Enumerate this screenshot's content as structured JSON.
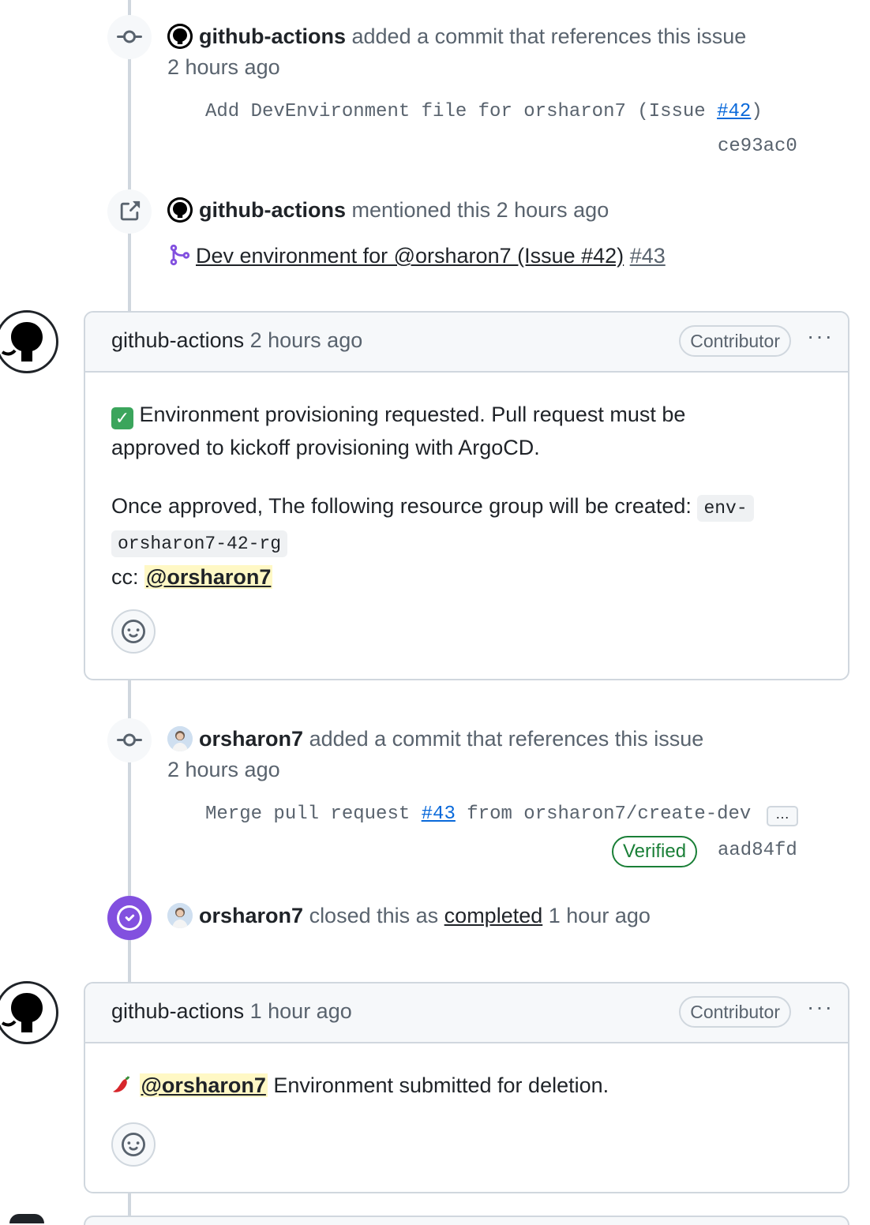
{
  "events": {
    "commit1": {
      "actor": "github-actions",
      "action": "added a commit that references this issue",
      "time": "2 hours ago",
      "message_prefix": "Add DevEnvironment file for orsharon7 (Issue ",
      "message_link": "#42",
      "message_suffix": ")",
      "sha": "ce93ac0"
    },
    "mention": {
      "actor": "github-actions",
      "action": "mentioned this 2 hours ago",
      "pr_title": "Dev environment for @orsharon7 (Issue #42)",
      "pr_number": "#43"
    },
    "commit2": {
      "actor": "orsharon7",
      "action": "added a commit that references this issue",
      "time": "2 hours ago",
      "message_prefix": "Merge pull request ",
      "message_link": "#43",
      "message_suffix": " from orsharon7/create-dev",
      "ellipsis": "…",
      "verified": "Verified",
      "sha": "aad84fd"
    },
    "closed": {
      "actor": "orsharon7",
      "action": "closed this as",
      "reason": "completed",
      "time": "1 hour ago"
    }
  },
  "comments": [
    {
      "author": "github-actions",
      "time": "2 hours ago",
      "role": "Contributor",
      "menu": "···",
      "line1": "Environment provisioning requested. Pull request must be",
      "line2": "approved to kickoff provisioning with ArgoCD.",
      "line3": "Once approved, The following resource group will be created:",
      "code1": "env-",
      "code2": "orsharon7-42-rg",
      "cc_label": "cc:",
      "mention": "@orsharon7"
    },
    {
      "author": "github-actions",
      "time": "1 hour ago",
      "role": "Contributor",
      "menu": "···",
      "mention": "@orsharon7",
      "text": "Environment submitted for deletion."
    }
  ],
  "icons": {
    "commit": "git-commit-icon",
    "crossref": "link-external-icon",
    "pr": "git-pull-request-icon",
    "closed": "check-circle-icon",
    "react": "smiley-icon",
    "check": "white-check-mark-emoji",
    "pepper": "hot-pepper-emoji"
  },
  "colors": {
    "link": "#0969da",
    "purple": "#8250df",
    "verified": "#1a7f37",
    "mention_bg": "#fff8c5"
  }
}
